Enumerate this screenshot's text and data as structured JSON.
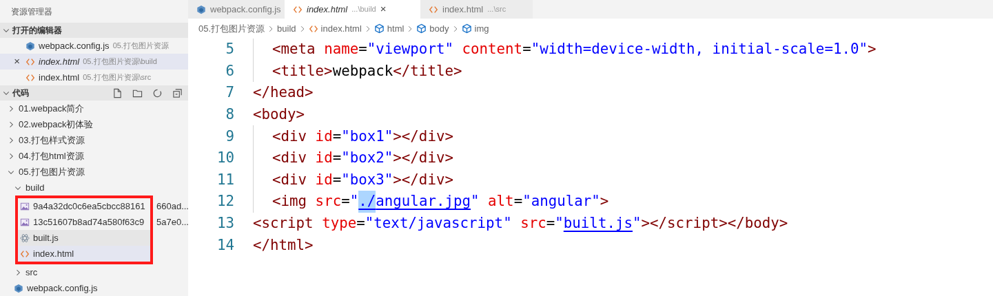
{
  "sidebar": {
    "title": "资源管理器",
    "open_editors": {
      "title": "打开的编辑器",
      "expanded": true,
      "items": [
        {
          "kind": "webpack",
          "name": "webpack.config.js",
          "path": "05.打包图片资源",
          "selected": false
        },
        {
          "kind": "html",
          "name": "index.html",
          "path": "05.打包图片资源\\build",
          "selected": true,
          "close": "×"
        },
        {
          "kind": "html",
          "name": "index.html",
          "path": "05.打包图片资源\\src",
          "selected": false
        }
      ]
    },
    "folder": {
      "title": "代码",
      "expanded": true,
      "items": [
        {
          "kind": "folder",
          "name": "01.webpack简介",
          "expanded": false
        },
        {
          "kind": "folder",
          "name": "02.webpack初体验",
          "expanded": false
        },
        {
          "kind": "folder",
          "name": "03.打包样式资源",
          "expanded": false
        },
        {
          "kind": "folder",
          "name": "04.打包html资源",
          "expanded": false
        },
        {
          "kind": "folder",
          "name": "05.打包图片资源",
          "expanded": true,
          "children": [
            {
              "kind": "folder",
              "name": "build",
              "expanded": true,
              "children": [
                {
                  "kind": "image",
                  "name": "9a4a32dc0c6ea5cbcc88161",
                  "name_after": "660ad...",
                  "selected": false,
                  "boxed": true
                },
                {
                  "kind": "image",
                  "name": "13c51607b8ad74a580f63c9",
                  "name_after": "5a7e0...",
                  "selected": false,
                  "boxed": true
                },
                {
                  "kind": "js",
                  "name": "built.js",
                  "selected": false,
                  "hovered": true,
                  "boxed": true
                },
                {
                  "kind": "html",
                  "name": "index.html",
                  "selected": true,
                  "boxed": true
                }
              ]
            },
            {
              "kind": "folder",
              "name": "src",
              "expanded": false
            },
            {
              "kind": "webpack",
              "name": "webpack.config.js",
              "selected": false
            }
          ]
        }
      ]
    }
  },
  "tabs": [
    {
      "kind": "webpack",
      "label": "webpack.config.js",
      "selected": false
    },
    {
      "kind": "html",
      "label": "index.html",
      "desc": "...\\build",
      "selected": true,
      "close": "×"
    },
    {
      "kind": "html",
      "label": "index.html",
      "desc": "...\\src",
      "selected": false
    }
  ],
  "breadcrumb": [
    {
      "kind": "text",
      "label": "05.打包图片资源"
    },
    {
      "kind": "text",
      "label": "build"
    },
    {
      "kind": "html",
      "label": "index.html"
    },
    {
      "kind": "symbol",
      "label": "html"
    },
    {
      "kind": "symbol",
      "label": "body"
    },
    {
      "kind": "symbol",
      "label": "img"
    }
  ],
  "code": [
    {
      "number": "5",
      "indented": true,
      "tokens": [
        {
          "kind": "tag",
          "text": "<meta "
        },
        {
          "kind": "attr",
          "text": "name"
        },
        {
          "kind": "plain",
          "text": "="
        },
        {
          "kind": "str",
          "text": "\"viewport\" "
        },
        {
          "kind": "attr",
          "text": "content"
        },
        {
          "kind": "plain",
          "text": "="
        },
        {
          "kind": "str",
          "text": "\"width=device-width, initial-scale=1.0\""
        },
        {
          "kind": "tag",
          "text": ">"
        }
      ]
    },
    {
      "number": "6",
      "indented": true,
      "tokens": [
        {
          "kind": "tag",
          "text": "<title>"
        },
        {
          "kind": "plain",
          "text": "webpack"
        },
        {
          "kind": "tag",
          "text": "</title>"
        }
      ]
    },
    {
      "number": "7",
      "indented": false,
      "tokens": [
        {
          "kind": "tag",
          "text": "</head>"
        }
      ]
    },
    {
      "number": "8",
      "indented": false,
      "tokens": [
        {
          "kind": "tag",
          "text": "<body>"
        }
      ]
    },
    {
      "number": "9",
      "indented": true,
      "tokens": [
        {
          "kind": "tag",
          "text": "<div "
        },
        {
          "kind": "attr",
          "text": "id"
        },
        {
          "kind": "plain",
          "text": "="
        },
        {
          "kind": "str",
          "text": "\"box1\""
        },
        {
          "kind": "tag",
          "text": "></div>"
        }
      ]
    },
    {
      "number": "10",
      "indented": true,
      "tokens": [
        {
          "kind": "tag",
          "text": "<div "
        },
        {
          "kind": "attr",
          "text": "id"
        },
        {
          "kind": "plain",
          "text": "="
        },
        {
          "kind": "str",
          "text": "\"box2\""
        },
        {
          "kind": "tag",
          "text": "></div>"
        }
      ]
    },
    {
      "number": "11",
      "indented": true,
      "tokens": [
        {
          "kind": "tag",
          "text": "<div "
        },
        {
          "kind": "attr",
          "text": "id"
        },
        {
          "kind": "plain",
          "text": "="
        },
        {
          "kind": "str",
          "text": "\"box3\""
        },
        {
          "kind": "tag",
          "text": "></div>"
        }
      ]
    },
    {
      "number": "12",
      "indented": true,
      "tokens": [
        {
          "kind": "tag",
          "text": "<img "
        },
        {
          "kind": "attr",
          "text": "src"
        },
        {
          "kind": "plain",
          "text": "="
        },
        {
          "kind": "str",
          "text": "\""
        },
        {
          "kind": "selection",
          "text": "./"
        },
        {
          "kind": "link",
          "text": "angular.jpg"
        },
        {
          "kind": "str",
          "text": "\" "
        },
        {
          "kind": "attr",
          "text": "alt"
        },
        {
          "kind": "plain",
          "text": "="
        },
        {
          "kind": "str",
          "text": "\"angular\""
        },
        {
          "kind": "tag",
          "text": ">"
        }
      ]
    },
    {
      "number": "13",
      "indented": false,
      "tokens": [
        {
          "kind": "tag",
          "text": "<script "
        },
        {
          "kind": "attr",
          "text": "type"
        },
        {
          "kind": "plain",
          "text": "="
        },
        {
          "kind": "str",
          "text": "\"text/javascript\" "
        },
        {
          "kind": "attr",
          "text": "src"
        },
        {
          "kind": "plain",
          "text": "="
        },
        {
          "kind": "str",
          "text": "\""
        },
        {
          "kind": "link",
          "text": "built.js"
        },
        {
          "kind": "str",
          "text": "\""
        },
        {
          "kind": "tag",
          "text": "></script></body>"
        }
      ]
    },
    {
      "number": "14",
      "indented": false,
      "tokens": [
        {
          "kind": "tag",
          "text": "</html>"
        }
      ]
    }
  ]
}
